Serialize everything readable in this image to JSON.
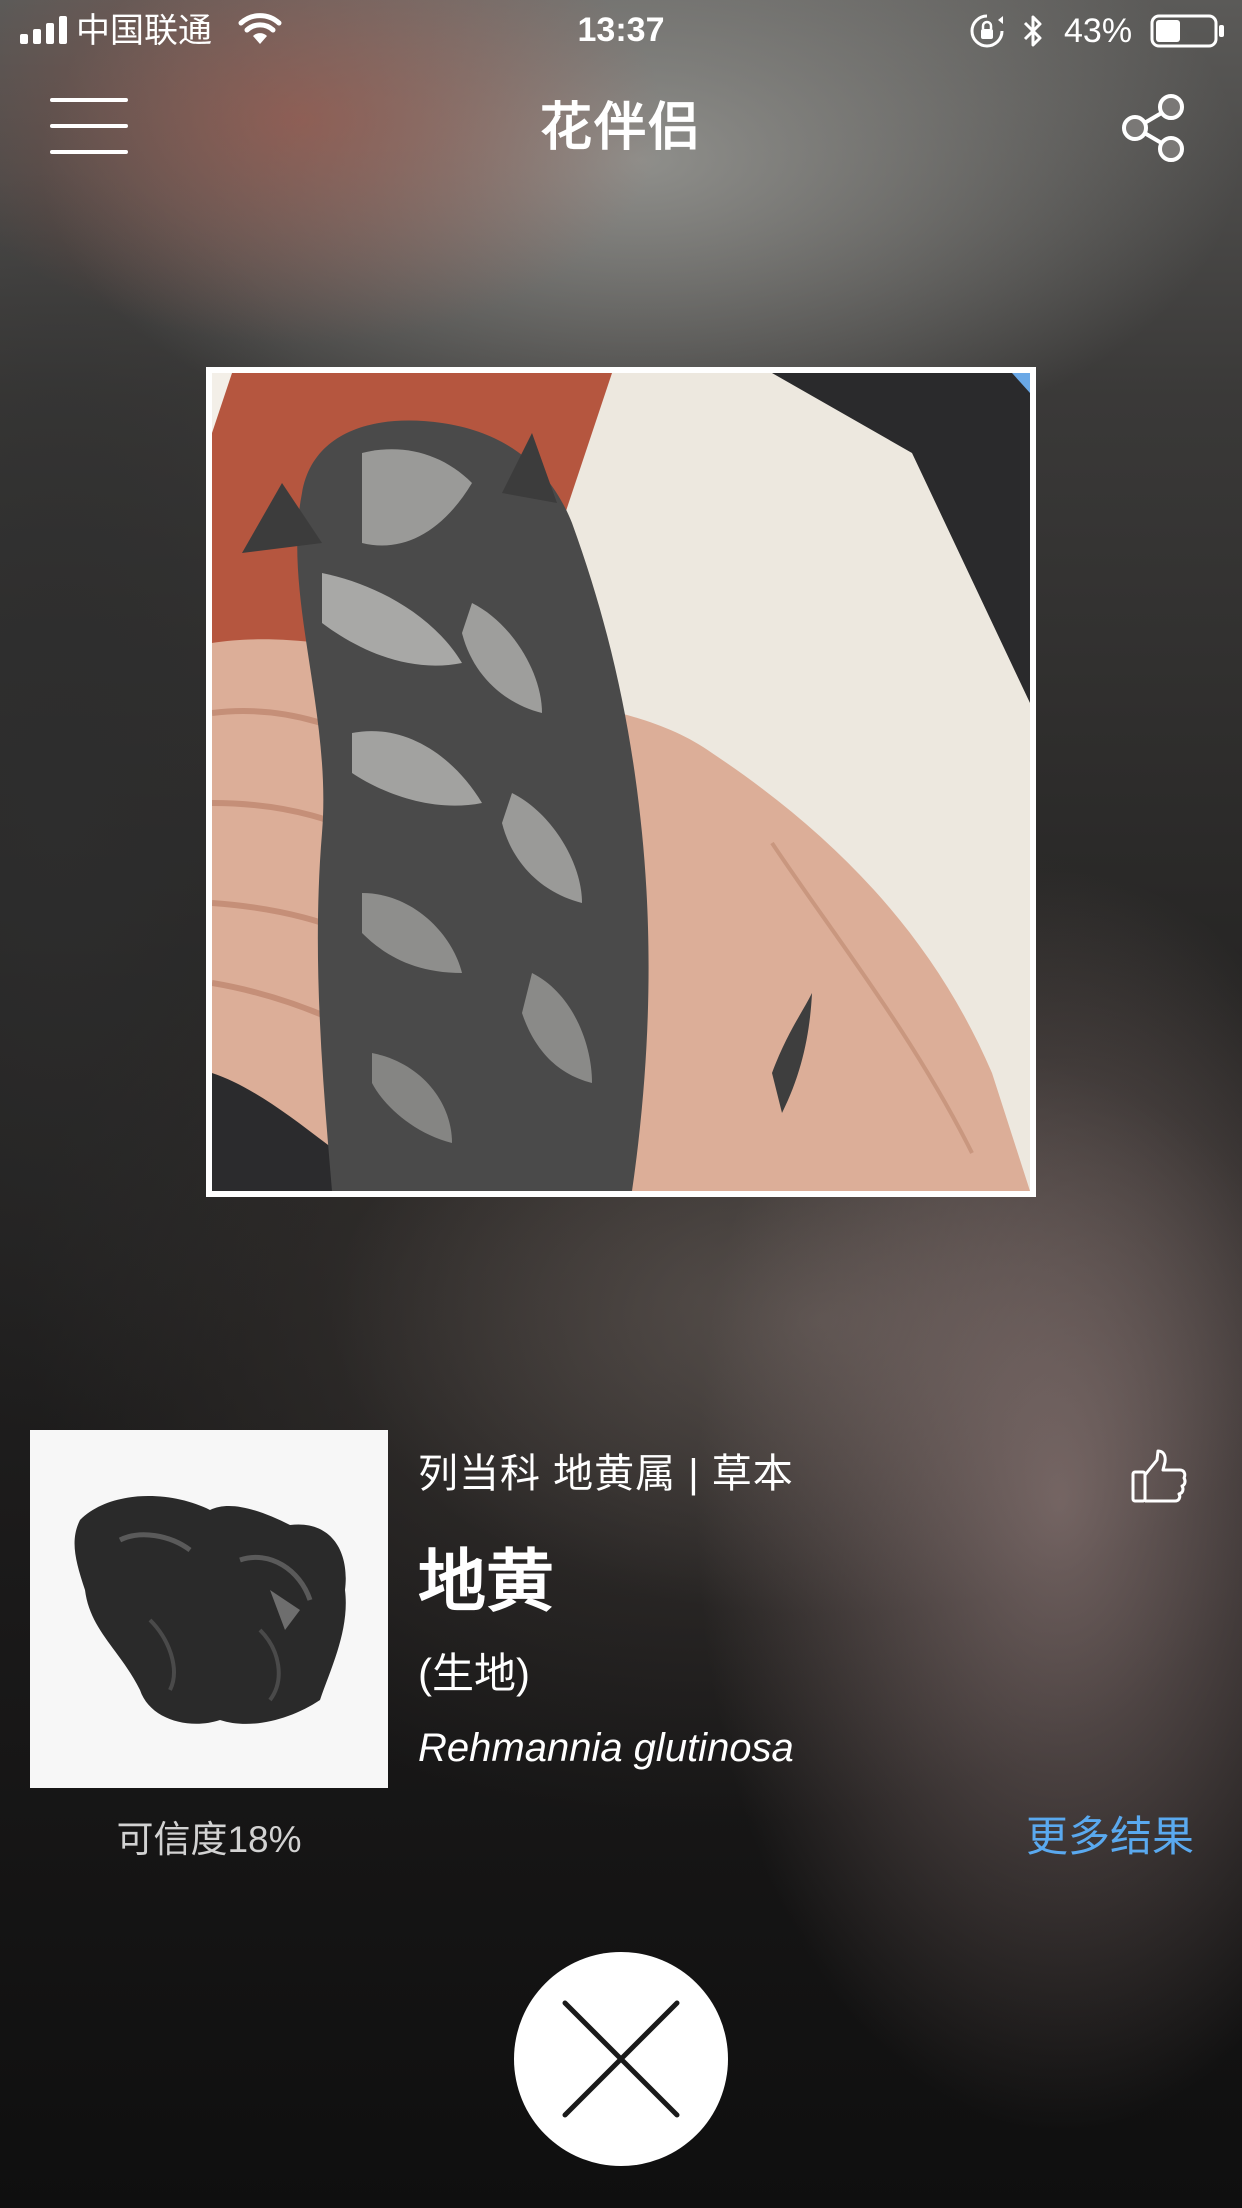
{
  "status_bar": {
    "carrier": "中国联通",
    "time": "13:37",
    "battery_percent": "43%",
    "battery_level": 0.43,
    "icons": [
      "signal-icon",
      "wifi-icon",
      "orientation-lock-icon",
      "bluetooth-icon",
      "battery-icon"
    ]
  },
  "nav": {
    "title": "花伴侣",
    "menu_icon": "menu-icon",
    "share_icon": "share-icon"
  },
  "photo": {
    "subject": "photo-of-kitten-in-hand"
  },
  "result": {
    "family_line": "列当科 地黄属 | 草本",
    "name": "地黄",
    "alias": "(生地)",
    "latin_name": "Rehmannia glutinosa",
    "confidence": "可信度18%",
    "more_results": "更多结果",
    "like_icon": "thumbs-up-icon",
    "thumb": "specimen-photo"
  },
  "close_button": {
    "icon": "close-icon"
  },
  "colors": {
    "link": "#5aa9ef",
    "text": "#ffffff",
    "confidence_text": "#d2d2d2"
  }
}
